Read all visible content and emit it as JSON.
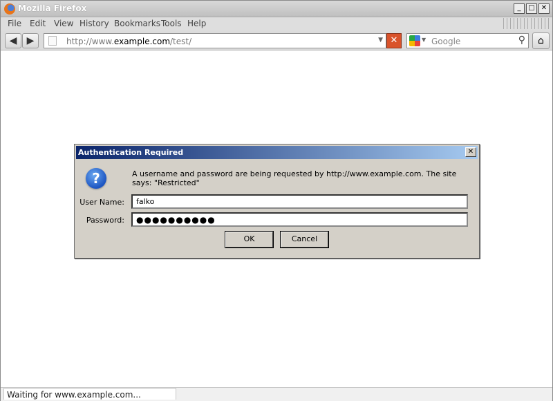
{
  "window": {
    "title": "Mozilla Firefox",
    "controls": [
      "_",
      "□",
      "✕"
    ]
  },
  "menu": [
    "File",
    "Edit",
    "View",
    "History",
    "Bookmarks",
    "Tools",
    "Help"
  ],
  "navbar": {
    "url_prefix": "http://www.",
    "url_host": "example.com",
    "url_path": "/test/",
    "search_placeholder": "Google"
  },
  "status": {
    "text": "Waiting for www.example.com..."
  },
  "dialog": {
    "title": "Authentication Required",
    "close": "✕",
    "message": "A username and password are being requested by http://www.example.com. The site says: \"Restricted\"",
    "username_label": "User Name:",
    "username_value": "falko",
    "password_label": "Password:",
    "password_value": "●●●●●●●●●●",
    "ok_label": "OK",
    "cancel_label": "Cancel"
  }
}
